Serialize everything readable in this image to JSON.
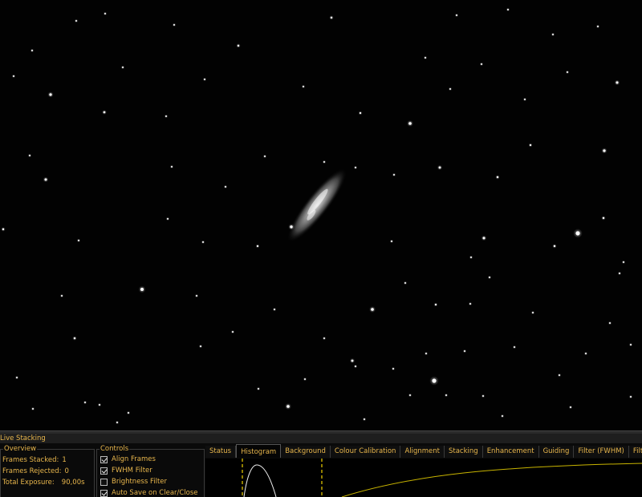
{
  "window": {
    "panel_title": "Live Stacking"
  },
  "overview": {
    "label": "Overview",
    "frames_stacked_label": "Frames Stacked:",
    "frames_stacked": "1",
    "frames_rejected_label": "Frames Rejected:",
    "frames_rejected": "0",
    "total_exposure_label": "Total Exposure:",
    "total_exposure": "90,00s"
  },
  "controls": {
    "label": "Controls",
    "items": [
      {
        "label": "Align Frames",
        "checked": true
      },
      {
        "label": "FWHM Filter",
        "checked": true
      },
      {
        "label": "Brightness Filter",
        "checked": false
      },
      {
        "label": "Auto Save on Clear/Close",
        "checked": true
      }
    ]
  },
  "tabs": [
    "Status",
    "Histogram",
    "Background",
    "Colour Calibration",
    "Alignment",
    "Stacking",
    "Enhancement",
    "Guiding",
    "Filter (FWHM)",
    "Filter (Brightness"
  ],
  "active_tab": "Histogram",
  "colors": {
    "accent": "#e8b64c",
    "curve": "#c8b400",
    "marker": "#f0d000"
  }
}
